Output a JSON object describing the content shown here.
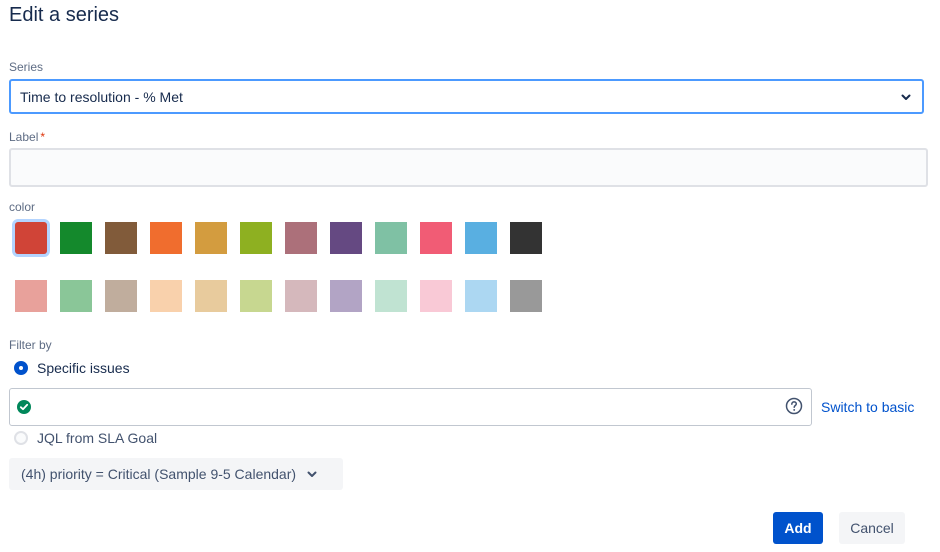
{
  "dialog": {
    "title": "Edit a series"
  },
  "series": {
    "label": "Series",
    "value": "Time to resolution - % Met"
  },
  "label_field": {
    "label": "Label",
    "required_mark": "*",
    "value": ""
  },
  "color": {
    "label": "color",
    "selected_index": 0,
    "row1": [
      "#d04437",
      "#14892c",
      "#815b3a",
      "#f06d2e",
      "#d39c3f",
      "#8eb021",
      "#ac707a",
      "#654982",
      "#7fc1a4",
      "#f15c75",
      "#59afe1",
      "#333333"
    ],
    "row2": [
      "#e8a19b",
      "#8ac698",
      "#c0ad9d",
      "#f9d1ac",
      "#e8cb9d",
      "#c7d790",
      "#d5b8bc",
      "#b2a4c5",
      "#c0e3d2",
      "#f9c9d6",
      "#acd7f2",
      "#999999"
    ]
  },
  "filter": {
    "label": "Filter by",
    "option_specific": "Specific issues",
    "option_jql": "JQL from SLA Goal",
    "selected": "specific",
    "jql_value": "",
    "switch_link": "Switch to basic",
    "goal_button": "(4h) priority = Critical (Sample 9-5 Calendar)"
  },
  "actions": {
    "add": "Add",
    "cancel": "Cancel"
  }
}
